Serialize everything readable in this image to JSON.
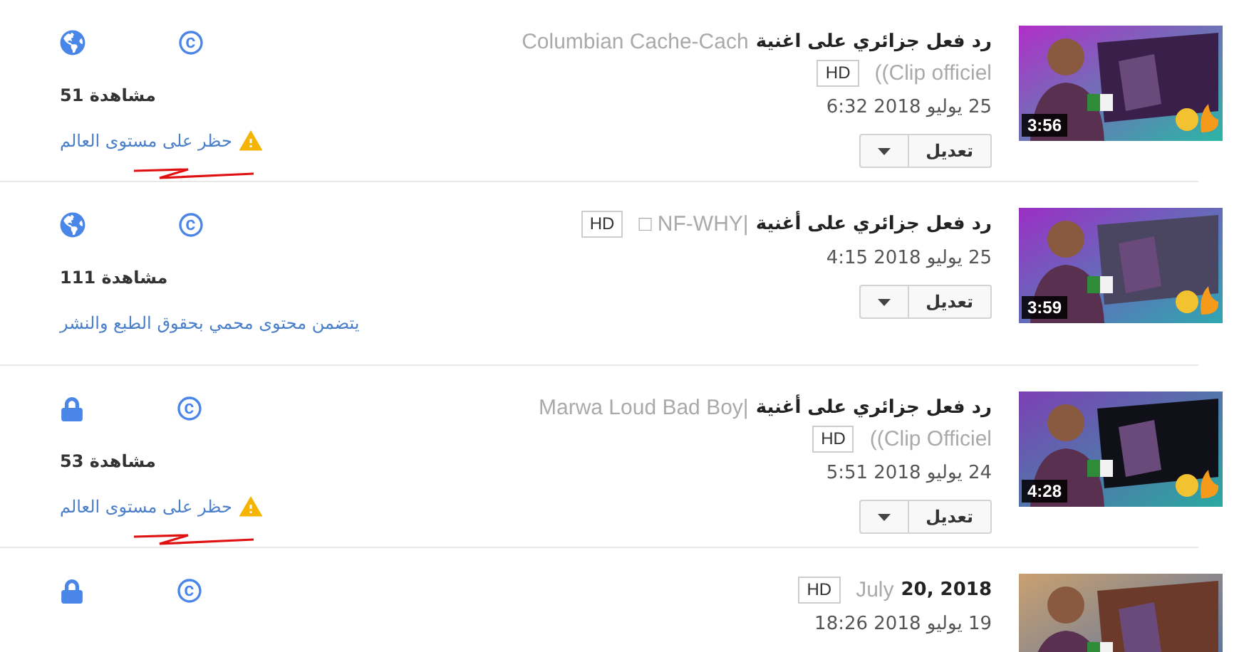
{
  "videos": [
    {
      "private": false,
      "views": "51 مشاهدة",
      "notice": {
        "kind": "warning",
        "text": "حظر على مستوى العالم"
      },
      "scribble": true,
      "title_lines": [
        {
          "bold": "رد فعل جزائري على اغنية",
          "light": "Columbian Cache-Cach"
        },
        {
          "light": "((Clip officiel",
          "badge": "HD"
        }
      ],
      "date": "25 يوليو 2018 6:32",
      "edit_button": "تعديل",
      "thumbnail": {
        "kind": "picture",
        "duration": "3:56"
      }
    },
    {
      "private": false,
      "views": "111 مشاهدة",
      "notice": {
        "kind": "info",
        "text": "يتضمن محتوى محمي بحقوق الطبع والنشر"
      },
      "scribble": false,
      "title_lines": [
        {
          "bold": "رد فعل جزائري على أغنية",
          "light": "□ NF-WHY|",
          "badge": "HD"
        }
      ],
      "date": "25 يوليو 2018 4:15",
      "edit_button": "تعديل",
      "thumbnail": {
        "kind": "picture",
        "duration": "3:59"
      }
    },
    {
      "private": true,
      "views": "53 مشاهدة",
      "notice": {
        "kind": "warning",
        "text": "حظر على مستوى العالم"
      },
      "scribble": true,
      "title_lines": [
        {
          "bold": "رد فعل جزائري على أغنية",
          "light": "Marwa Loud Bad Boy|"
        },
        {
          "light": "((Clip Officiel",
          "badge": "HD"
        }
      ],
      "date": "24 يوليو 2018 5:51",
      "edit_button": "تعديل",
      "thumbnail": {
        "kind": "picture",
        "duration": "4:28"
      }
    },
    {
      "private": true,
      "scribble": false,
      "title_lines": [
        {
          "bold": "20, 2018",
          "light": "July",
          "badge": "HD"
        }
      ],
      "date": "19 يوليو 2018 18:26",
      "thumbnail": {
        "kind": "picture"
      }
    }
  ]
}
